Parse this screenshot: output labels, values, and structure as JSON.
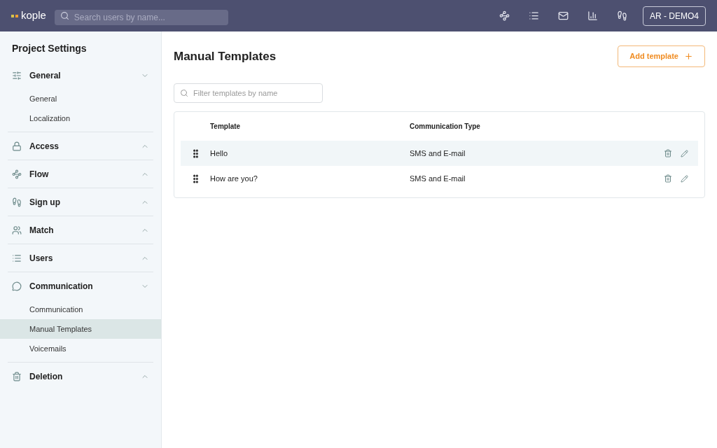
{
  "topbar": {
    "logo": "kople",
    "search": {
      "placeholder": "Search users by name..."
    },
    "account": "AR - DEMO4"
  },
  "sidebar": {
    "title": "Project Settings",
    "sections": [
      {
        "label": "General",
        "expanded": true,
        "children": [
          {
            "label": "General",
            "selected": false
          },
          {
            "label": "Localization",
            "selected": false
          }
        ]
      },
      {
        "label": "Access",
        "expanded": false
      },
      {
        "label": "Flow",
        "expanded": false
      },
      {
        "label": "Sign up",
        "expanded": false
      },
      {
        "label": "Match",
        "expanded": false
      },
      {
        "label": "Users",
        "expanded": false
      },
      {
        "label": "Communication",
        "expanded": true,
        "children": [
          {
            "label": "Communication",
            "selected": false
          },
          {
            "label": "Manual Templates",
            "selected": true
          },
          {
            "label": "Voicemails",
            "selected": false
          }
        ]
      },
      {
        "label": "Deletion",
        "expanded": false
      }
    ]
  },
  "page": {
    "title": "Manual Templates",
    "add_button": "Add template",
    "filter": {
      "placeholder": "Filter templates by name"
    },
    "table": {
      "columns": [
        "Template",
        "Communication Type"
      ],
      "rows": [
        {
          "cells": [
            "Hello",
            "SMS and E-mail"
          ],
          "selected": true
        },
        {
          "cells": [
            "How are you?",
            "SMS and E-mail"
          ],
          "selected": false
        }
      ]
    }
  }
}
